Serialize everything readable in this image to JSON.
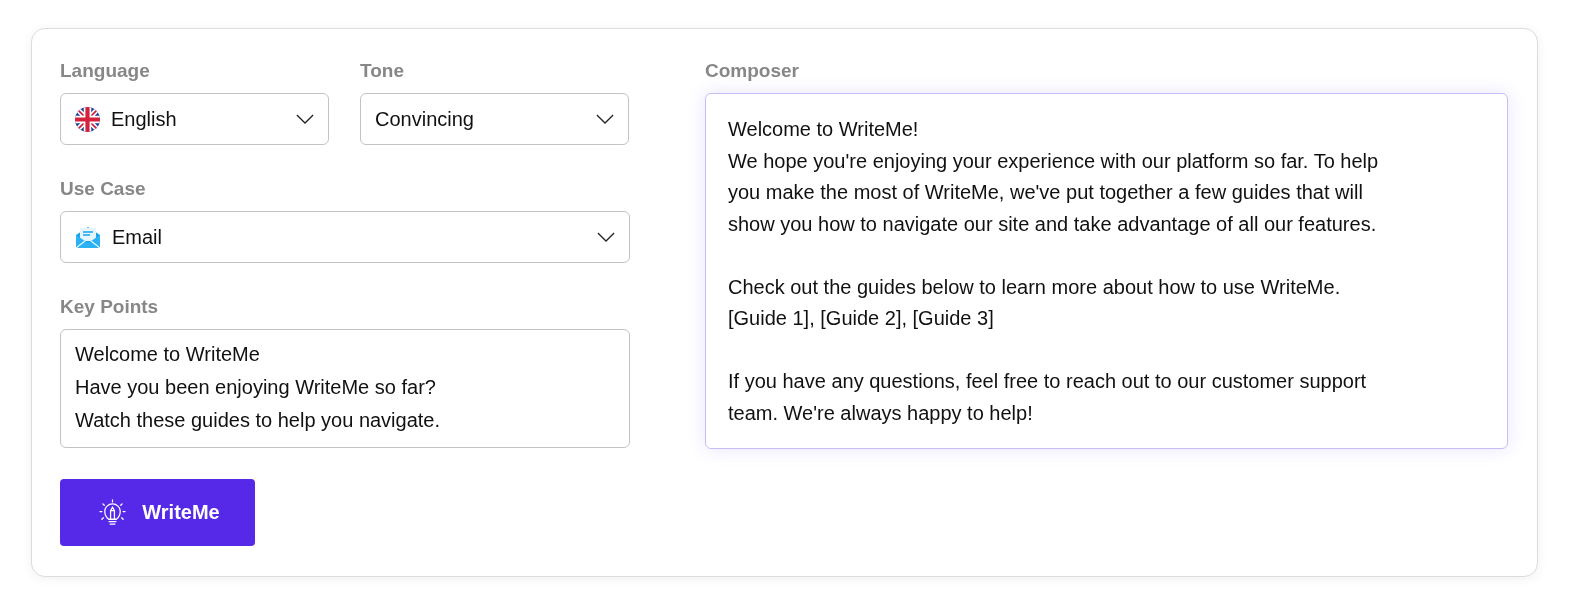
{
  "language": {
    "label": "Language",
    "value": "English"
  },
  "tone": {
    "label": "Tone",
    "value": "Convincing"
  },
  "use_case": {
    "label": "Use Case",
    "value": "Email"
  },
  "key_points": {
    "label": "Key Points",
    "lines": [
      "Welcome to WriteMe",
      "Have you been enjoying WriteMe so far?",
      "Watch these guides to help you navigate."
    ]
  },
  "action_button": {
    "label": "WriteMe"
  },
  "composer": {
    "label": "Composer",
    "paragraphs": [
      [
        "Welcome to WriteMe!",
        "We hope you're enjoying your experience with our platform so far. To help you make the most of WriteMe, we've put together a few guides that will show you how to navigate our site and take advantage of all our features."
      ],
      [
        "Check out the guides below to learn more about how to use WriteMe.",
        "[Guide 1], [Guide 2], [Guide 3]"
      ],
      [
        "If you have any questions, feel free to reach out to our customer support team. We're always happy to help!"
      ]
    ]
  }
}
